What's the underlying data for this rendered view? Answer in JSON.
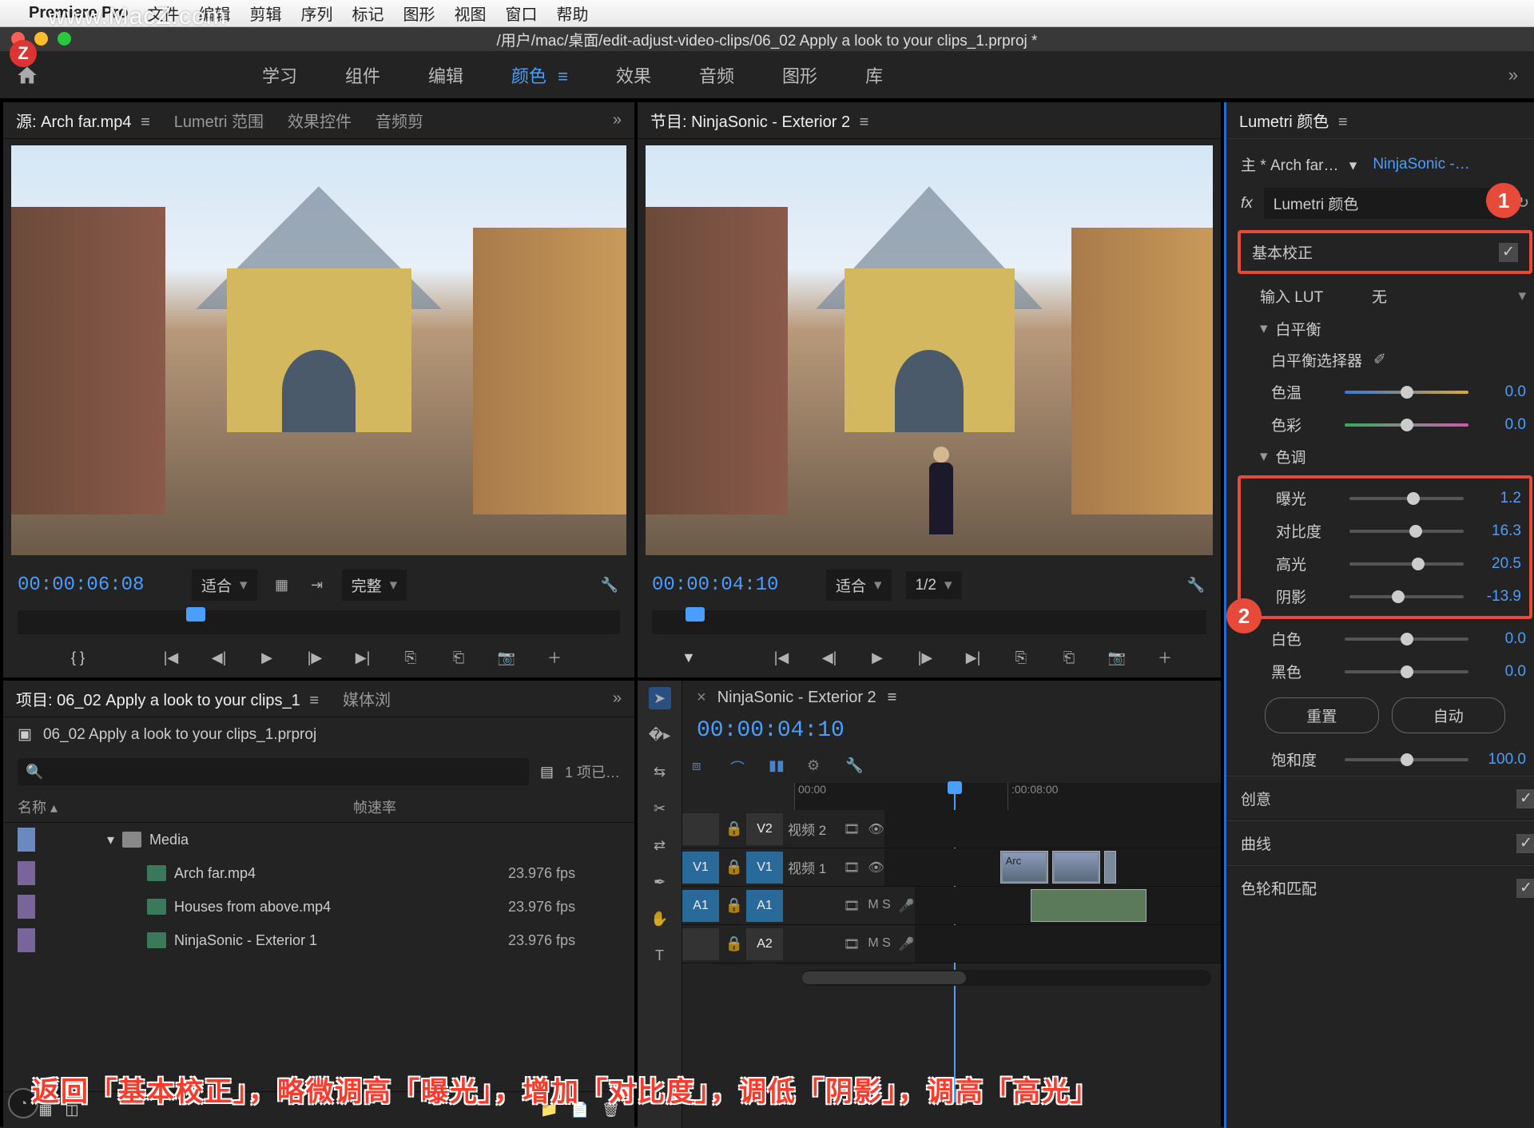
{
  "mac_menu": {
    "app": "Premiere Pro",
    "items": [
      "文件",
      "编辑",
      "剪辑",
      "序列",
      "标记",
      "图形",
      "视图",
      "窗口",
      "帮助"
    ]
  },
  "watermark": "www.MacZ.com",
  "watermark_badge": "Z",
  "titlebar": "/用户/mac/桌面/edit-adjust-video-clips/06_02 Apply a look to your clips_1.prproj *",
  "workspaces": {
    "home": "home",
    "tabs": [
      "学习",
      "组件",
      "编辑",
      "颜色",
      "效果",
      "音频",
      "图形",
      "库"
    ],
    "active": "颜色"
  },
  "source": {
    "tabs": [
      "源: Arch far.mp4",
      "Lumetri 范围",
      "效果控件",
      "音频剪"
    ],
    "timecode": "00:00:06:08",
    "fit": "适合",
    "res": "完整"
  },
  "program": {
    "tab": "节目: NinjaSonic - Exterior 2",
    "timecode": "00:00:04:10",
    "fit": "适合",
    "res": "1/2"
  },
  "lumetri": {
    "title": "Lumetri 颜色",
    "clip_label": "主 * Arch far…",
    "seq_label": "NinjaSonic -…",
    "fx_name": "Lumetri 颜色",
    "callout1": "1",
    "callout2": "2",
    "basic_correction": "基本校正",
    "input_lut_label": "输入 LUT",
    "input_lut_value": "无",
    "wb_group": "白平衡",
    "wb_picker": "白平衡选择器",
    "temp_label": "色温",
    "temp_value": "0.0",
    "tint_label": "色彩",
    "tint_value": "0.0",
    "tone_group": "色调",
    "exposure_label": "曝光",
    "exposure_value": "1.2",
    "contrast_label": "对比度",
    "contrast_value": "16.3",
    "highlights_label": "高光",
    "highlights_value": "20.5",
    "shadows_label": "阴影",
    "shadows_value": "-13.9",
    "whites_label": "白色",
    "whites_value": "0.0",
    "blacks_label": "黑色",
    "blacks_value": "0.0",
    "reset_btn": "重置",
    "auto_btn": "自动",
    "sat_label": "饱和度",
    "sat_value": "100.0",
    "acc_creative": "创意",
    "acc_curves": "曲线",
    "acc_wheels": "色轮和匹配"
  },
  "project": {
    "tab": "项目: 06_02 Apply a look to your clips_1",
    "tab2": "媒体浏",
    "filename": "06_02 Apply a look to your clips_1.prproj",
    "item_count": "1 项已…",
    "col_name": "名称",
    "col_fps": "帧速率",
    "rows": [
      {
        "name": "Media",
        "fps": "",
        "type": "folder"
      },
      {
        "name": "Arch far.mp4",
        "fps": "23.976 fps",
        "type": "video"
      },
      {
        "name": "Houses from above.mp4",
        "fps": "23.976 fps",
        "type": "video"
      },
      {
        "name": "NinjaSonic - Exterior 1",
        "fps": "23.976 fps",
        "type": "video"
      }
    ]
  },
  "timeline": {
    "seq_name": "NinjaSonic - Exterior 2",
    "timecode": "00:00:04:10",
    "ruler": [
      "00:00",
      ":00:08:00"
    ],
    "tracks": {
      "v2": {
        "src": "",
        "tgt": "V2",
        "name": "视频 2"
      },
      "v1": {
        "src": "V1",
        "tgt": "V1",
        "name": "视频 1"
      },
      "a1": {
        "src": "A1",
        "tgt": "A1",
        "name": ""
      },
      "a2": {
        "src": "",
        "tgt": "A2",
        "name": ""
      }
    },
    "clip_label": "Arc"
  },
  "caption": "返回「基本校正」，略微调高「曝光」，增加「对比度」，调低「阴影」，调高「高光」"
}
